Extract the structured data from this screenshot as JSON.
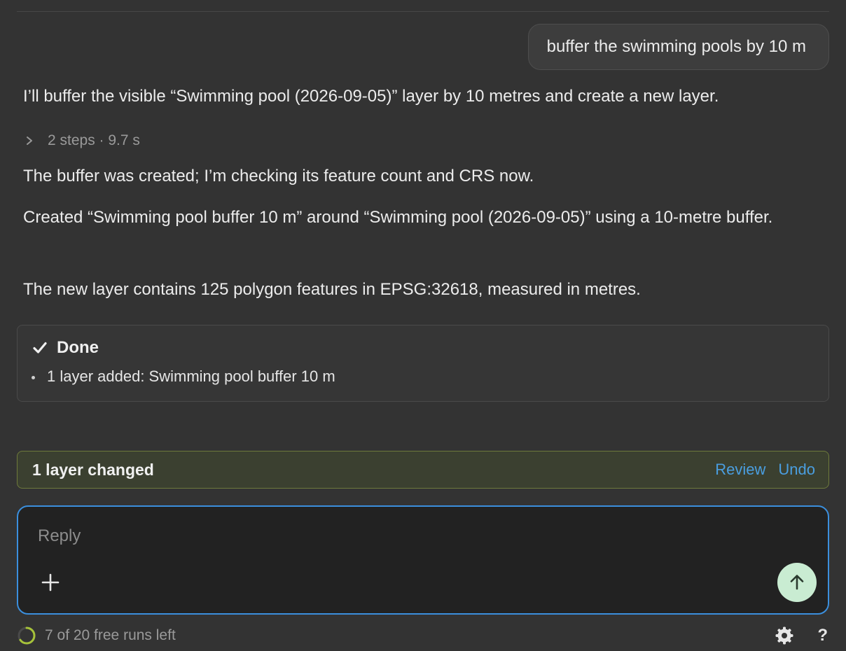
{
  "chat": {
    "user_message": "buffer the swimming pools by 10 m",
    "assistant_intro": "I’ll buffer the visible “Swimming pool (2026-09-05)” layer by 10 metres and create a new layer.",
    "steps_summary": "2 steps · 9.7 s",
    "status_message": "The buffer was created; I’m checking its feature count and CRS now.",
    "result_message": "Created “Swimming pool buffer 10 m” around “Swimming pool (2026-09-05)” using a 10-metre buffer.",
    "detail_message": "The new layer contains 125 polygon features in EPSG:32618, measured in metres."
  },
  "done_card": {
    "title": "Done",
    "items": [
      "1 layer added: Swimming pool buffer 10 m"
    ]
  },
  "change_bar": {
    "label": "1 layer changed",
    "review_label": "Review",
    "undo_label": "Undo"
  },
  "composer": {
    "placeholder": "Reply"
  },
  "footer": {
    "runs_text": "7 of 20 free runs left",
    "runs_used_fraction": 0.65,
    "help_label": "?"
  },
  "colors": {
    "background": "#333333",
    "accent_blue": "#3b8fdd",
    "link_blue": "#4a9ee0",
    "change_border": "#6e7a3c",
    "send_button": "#c9ecd2",
    "ring_progress": "#a6c23a"
  },
  "icons": {
    "steps_toggle": "chevron-right-icon",
    "done": "check-icon",
    "attach": "plus-icon",
    "send": "arrow-up-icon",
    "settings": "gear-icon",
    "runs": "progress-ring-icon"
  }
}
